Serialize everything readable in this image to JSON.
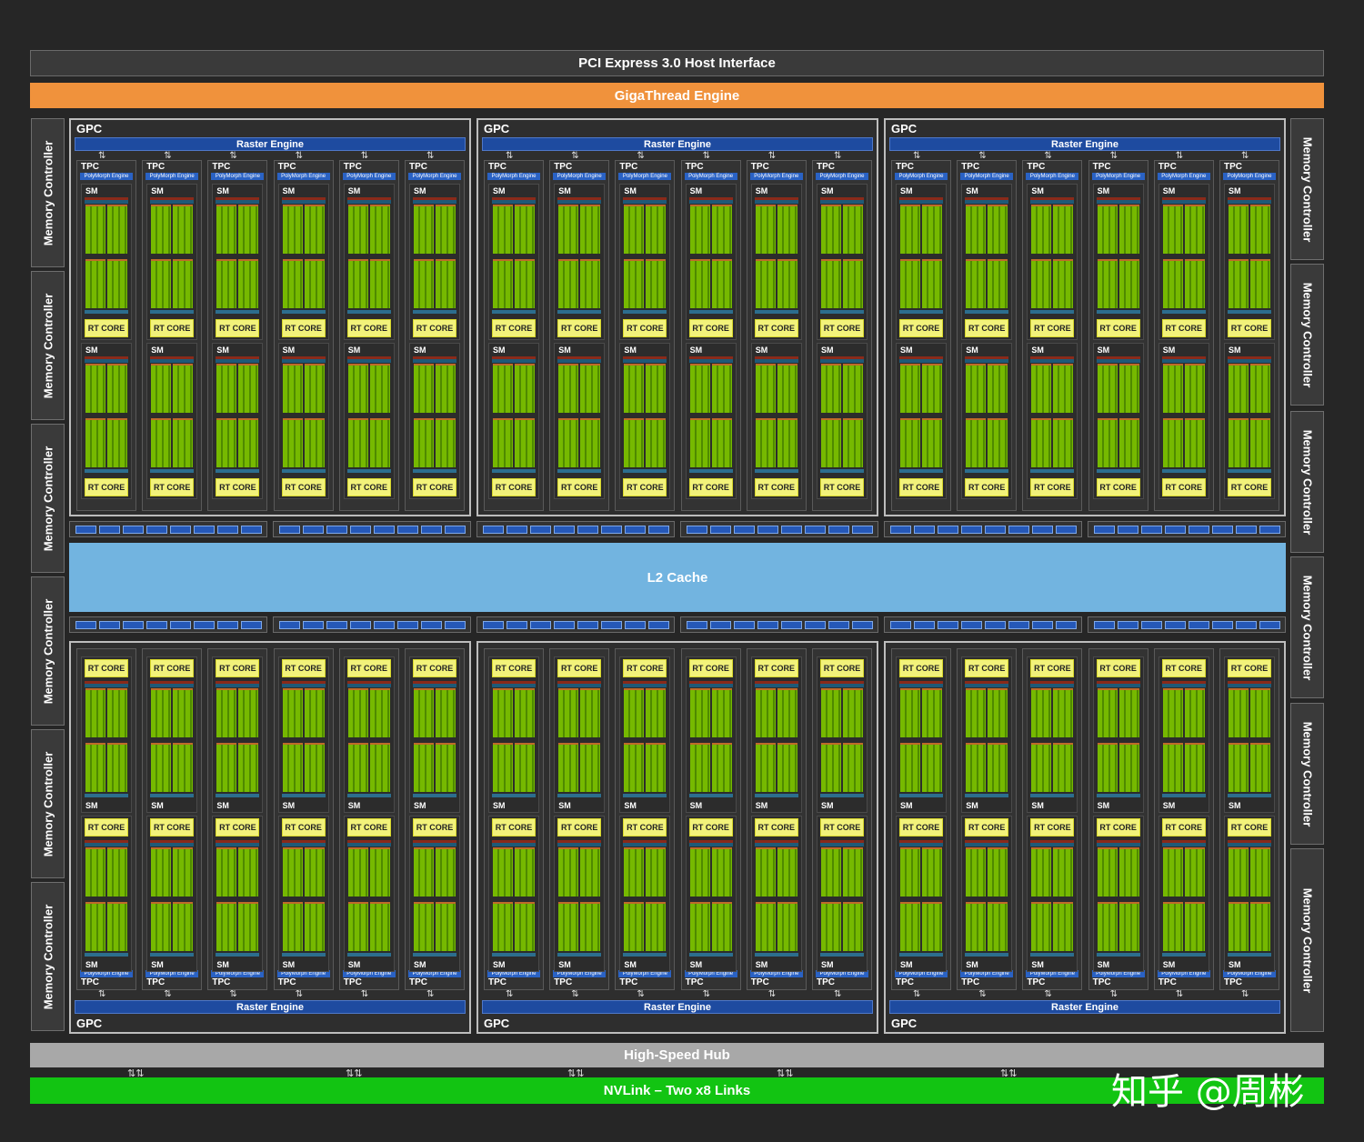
{
  "header": {
    "pci_express": "PCI Express 3.0 Host Interface",
    "gigathread": "GigaThread Engine"
  },
  "l2_cache": "L2 Cache",
  "high_speed_hub": "High-Speed Hub",
  "nvlink": "NVLink – Two x8 Links",
  "memory_controller": "Memory Controller",
  "gpc": {
    "label": "GPC",
    "raster_engine": "Raster Engine",
    "tpc_label": "TPC",
    "polymorph_engine": "PolyMorph Engine",
    "sm_label": "SM",
    "rt_core": "RT CORE"
  },
  "watermark": "知乎 @周彬",
  "colors": {
    "pci": "#3a3a3a",
    "gigathread": "#f0923c",
    "l2_cache": "#72b4e0",
    "high_speed_hub": "#a8a8a8",
    "nvlink": "#12c412",
    "raster_engine": "#1e4ba0",
    "rt_core": "#f2f27a",
    "cuda_cores": "#76b900"
  },
  "counts": {
    "gpcs": 6,
    "tpcs_per_gpc": 6,
    "sms_per_tpc": 2,
    "memory_controllers_per_side": 6,
    "l2_slice_groups": 12
  }
}
